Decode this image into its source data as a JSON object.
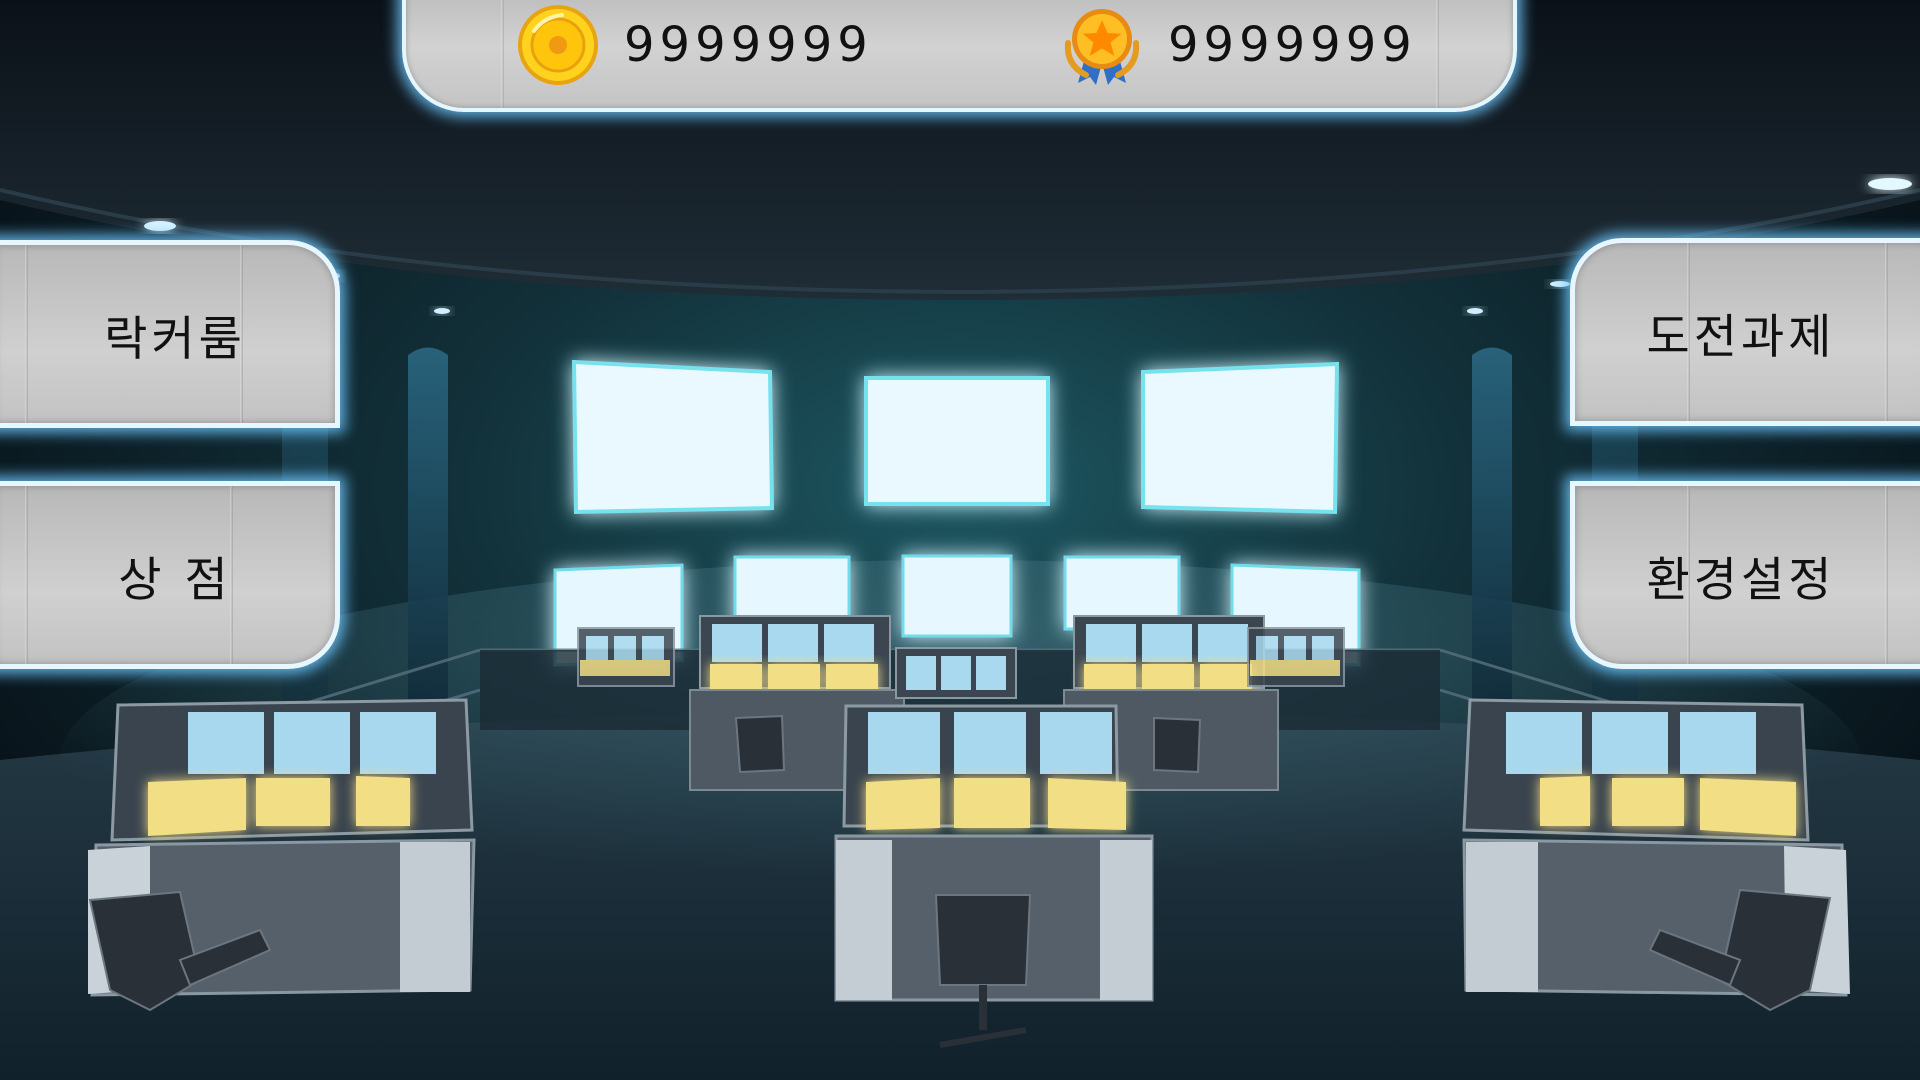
{
  "resources": {
    "coins": {
      "icon": "gold-coin-icon",
      "value": "9999999"
    },
    "medals": {
      "icon": "star-medal-icon",
      "value": "9999999"
    }
  },
  "menu": {
    "left": [
      {
        "id": "locker-room",
        "label": "락커룸"
      },
      {
        "id": "shop",
        "label": "상 점"
      }
    ],
    "right": [
      {
        "id": "challenges",
        "label": "도전과제"
      },
      {
        "id": "settings",
        "label": "환경설정"
      }
    ]
  },
  "colors": {
    "accent_glow": "#6ec8ff",
    "button_face": "#c6c6c6",
    "monitor_glow": "#2fc8d8",
    "console_screen": "#f2de85"
  }
}
